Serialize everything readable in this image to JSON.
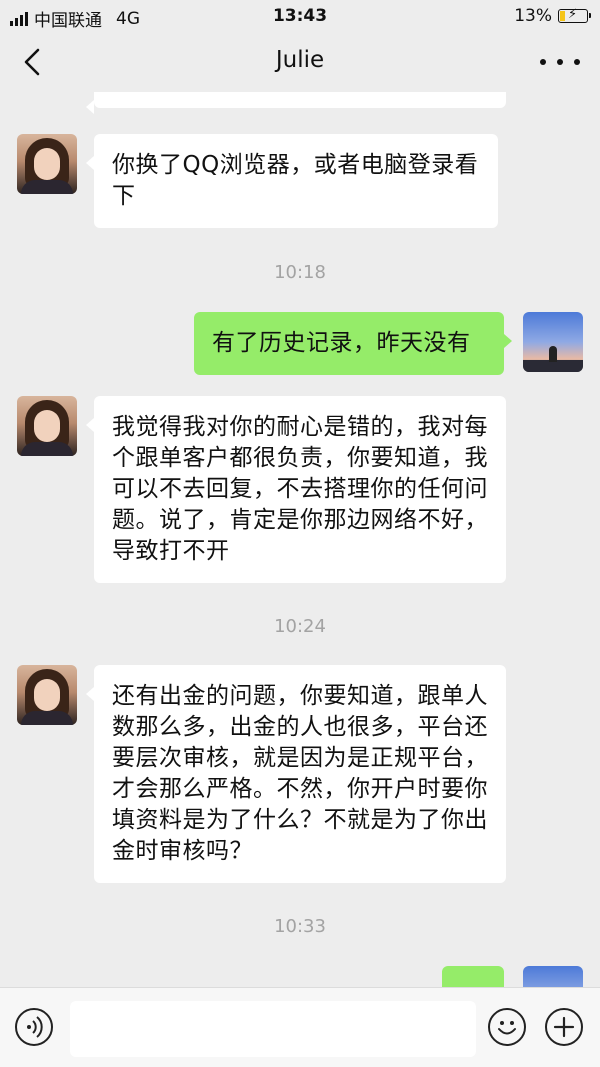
{
  "status_bar": {
    "carrier": "中国联通",
    "network": "4G",
    "time": "13:43",
    "battery_percent": "13%",
    "battery_level": 0.13
  },
  "header": {
    "title": "Julie",
    "back_icon": "chevron-left-icon",
    "more_icon": "more-dots-icon"
  },
  "messages": [
    {
      "from": "Julie",
      "side": "left",
      "text": "你换了QQ浏览器，或者电脑登录看下"
    },
    {
      "type": "time",
      "text": "10:18"
    },
    {
      "from": "me",
      "side": "right",
      "text": "有了历史记录，昨天没有"
    },
    {
      "from": "Julie",
      "side": "left",
      "text": "我觉得我对你的耐心是错的，我对每个跟单客户都很负责，你要知道，我可以不去回复，不去搭理你的任何问题。说了，肯定是你那边网络不好，导致打不开"
    },
    {
      "type": "time",
      "text": "10:24"
    },
    {
      "from": "Julie",
      "side": "left",
      "text": "还有出金的问题，你要知道，跟单人数那么多，出金的人也很多，平台还要层次审核，就是因为是正规平台，才会那么严格。不然，你开户时要你填资料是为了什么？不就是为了你出金时审核吗？"
    },
    {
      "type": "time",
      "text": "10:33"
    }
  ],
  "input_bar": {
    "voice_icon": "voice-icon",
    "emoji_icon": "emoji-icon",
    "plus_icon": "plus-icon",
    "message_value": ""
  },
  "colors": {
    "background": "#ededed",
    "bubble_incoming": "#ffffff",
    "bubble_outgoing": "#95ec69",
    "timestamp_text": "#a3a3a3"
  }
}
